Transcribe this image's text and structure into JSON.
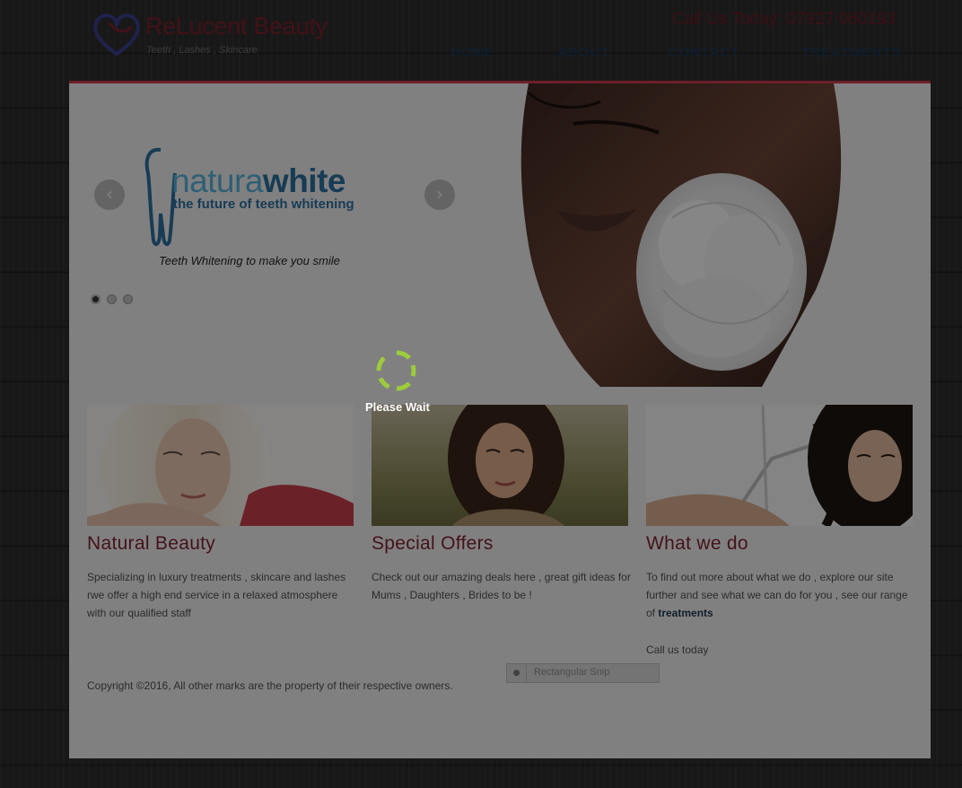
{
  "header": {
    "brand_name": "ReLucent Beauty",
    "brand_tagline": "Teeth , Lashes , Skincare",
    "phone": "Call Us Today: 07927 060193",
    "nav": [
      {
        "label": "HOME"
      },
      {
        "label": "ABOUT"
      },
      {
        "label": "CONTACT"
      },
      {
        "label": "TREATMENTS"
      }
    ]
  },
  "slider": {
    "brand_logo_word_light": "natura",
    "brand_logo_word_bold": "white",
    "brand_logo_subline": "the future of teeth whitening",
    "caption": "Teeth Whitening to make you smile",
    "prev_arrow": "‹",
    "next_arrow": "›",
    "slide_count": 3,
    "active_slide": 1
  },
  "features": [
    {
      "title": "Natural Beauty",
      "text": "Specializing in luxury treatments , skincare and lashes rwe offer a high end service in a relaxed atmosphere with our qualified staff"
    },
    {
      "title": "Special Offers",
      "text": "Check out our amazing deals here , great gift ideas for Mums , Daughters , Brides to be !"
    },
    {
      "title": "What we do",
      "text": "To find out more about what we do , explore our site further and see what we can do for you , see our range of ",
      "link_text": "treatments",
      "extra": "Call us today"
    }
  ],
  "footer": {
    "copyright": "Copyright ©2016, All other marks are the property of their respective owners."
  },
  "snip_tool": {
    "label": "Rectangular Snip"
  },
  "loading": {
    "text": "Please Wait"
  },
  "colors": {
    "accent_red": "#c63a4d",
    "brand_text": "#7a1f2c",
    "nav_text": "#1e3550",
    "spinner_green": "#9ccc3c",
    "logo_blue": "#2a6d9c"
  }
}
